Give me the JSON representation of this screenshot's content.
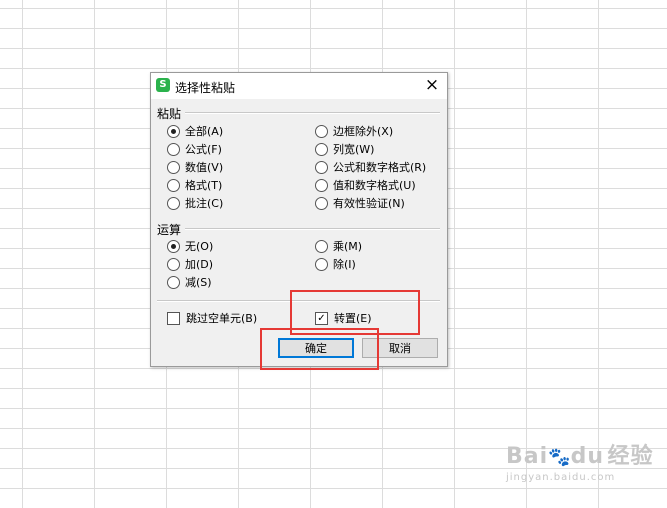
{
  "dialog": {
    "title": "选择性粘贴",
    "app_icon": "S",
    "close_glyph": "×"
  },
  "paste": {
    "label": "粘贴",
    "options": [
      {
        "label": "全部(A)",
        "selected": true
      },
      {
        "label": "边框除外(X)",
        "selected": false
      },
      {
        "label": "公式(F)",
        "selected": false
      },
      {
        "label": "列宽(W)",
        "selected": false
      },
      {
        "label": "数值(V)",
        "selected": false
      },
      {
        "label": "公式和数字格式(R)",
        "selected": false
      },
      {
        "label": "格式(T)",
        "selected": false
      },
      {
        "label": "值和数字格式(U)",
        "selected": false
      },
      {
        "label": "批注(C)",
        "selected": false
      },
      {
        "label": "有效性验证(N)",
        "selected": false
      }
    ]
  },
  "operation": {
    "label": "运算",
    "options": [
      {
        "label": "无(O)",
        "selected": true
      },
      {
        "label": "乘(M)",
        "selected": false
      },
      {
        "label": "加(D)",
        "selected": false
      },
      {
        "label": "除(I)",
        "selected": false
      },
      {
        "label": "减(S)",
        "selected": false
      }
    ]
  },
  "checkboxes": {
    "skip_blanks": {
      "label": "跳过空单元(B)",
      "checked": false
    },
    "transpose": {
      "label": "转置(E)",
      "checked": true
    }
  },
  "buttons": {
    "ok": "确定",
    "cancel": "取消"
  },
  "watermark": {
    "main": "Bai",
    "paw": "🐾",
    "du": "du",
    "cn": "经验",
    "sub": "jingyan.baidu.com"
  },
  "colors": {
    "highlight": "#e53935",
    "app_icon": "#2bb24c",
    "dialog_bg": "#f0f0f0"
  }
}
